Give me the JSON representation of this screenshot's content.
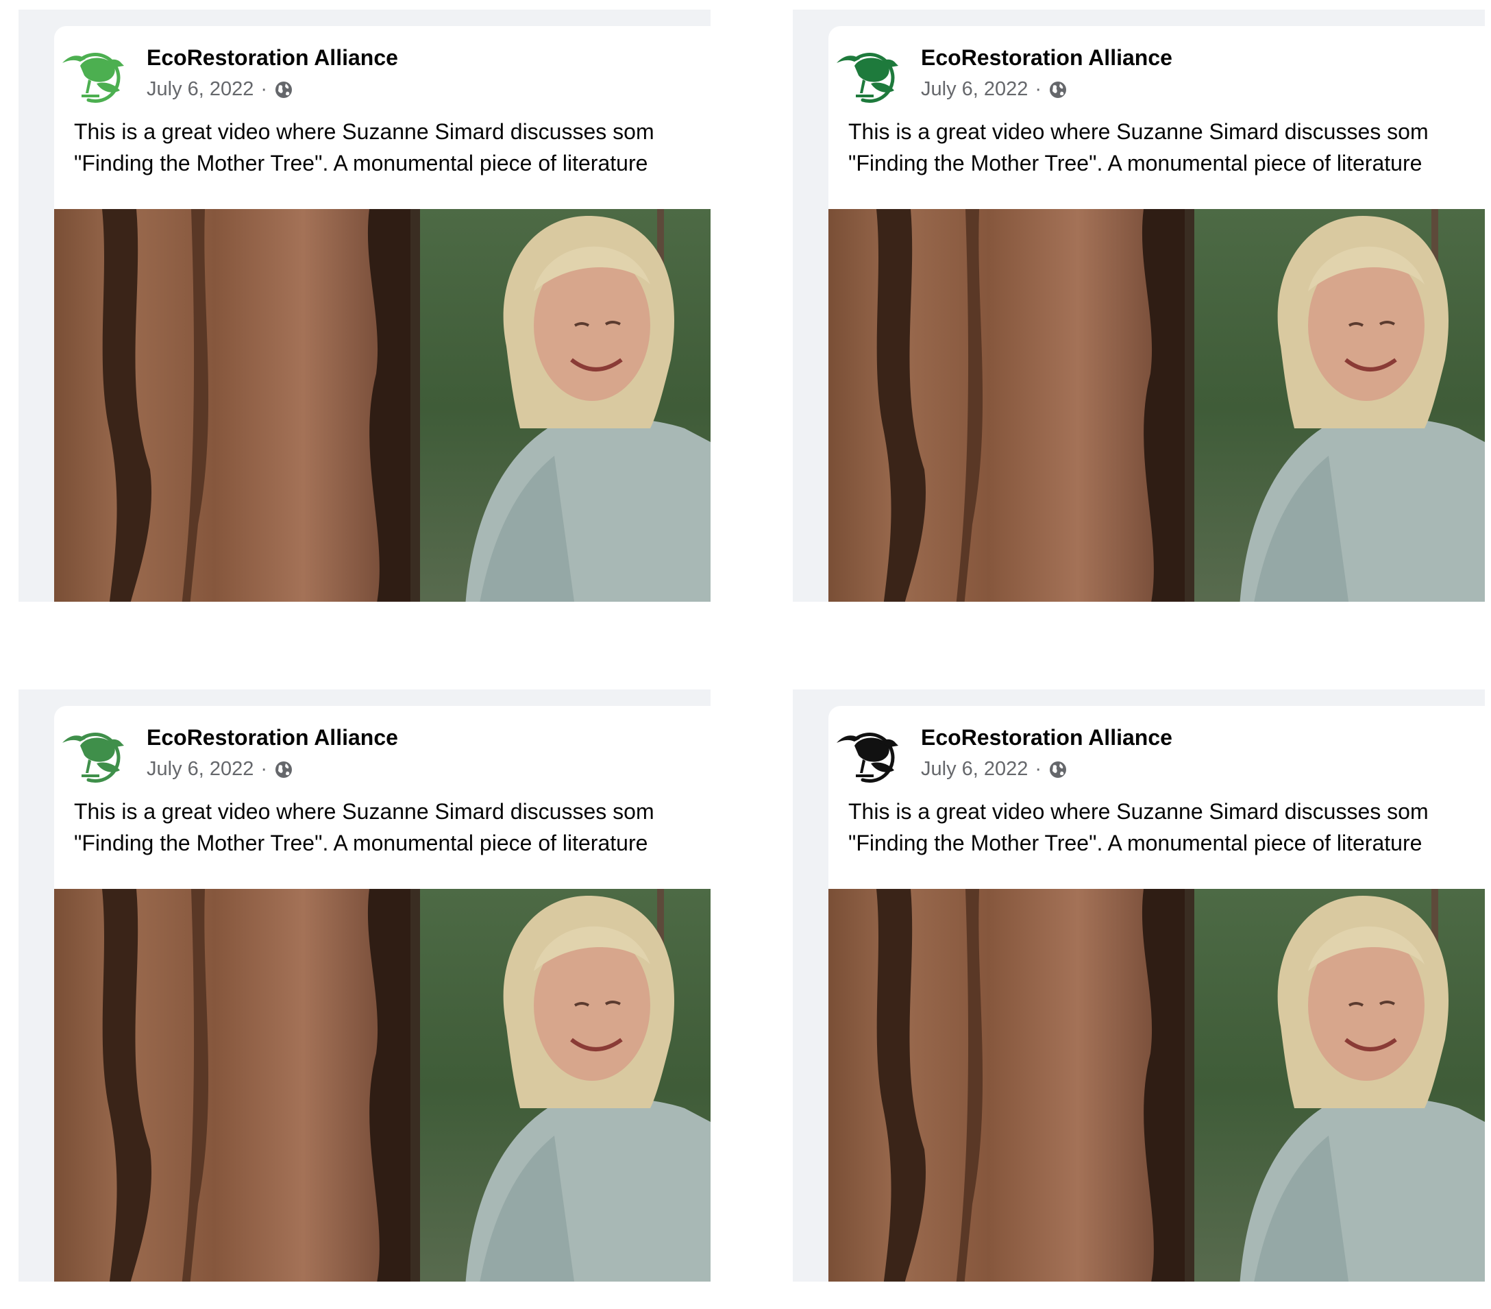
{
  "posts": [
    {
      "page_name": "EcoRestoration Alliance",
      "date": "July 6, 2022",
      "separator": "·",
      "audience_icon": "globe-icon",
      "logo_variant": "bright-green",
      "text_line_1": "This is a great video where Suzanne Simard discusses som",
      "text_line_2": "\"Finding the Mother Tree\". A monumental piece of literature"
    },
    {
      "page_name": "EcoRestoration Alliance",
      "date": "July 6, 2022",
      "separator": "·",
      "audience_icon": "globe-icon",
      "logo_variant": "dark-green",
      "text_line_1": "This is a great video where Suzanne Simard discusses som",
      "text_line_2": "\"Finding the Mother Tree\". A monumental piece of literature"
    },
    {
      "page_name": "EcoRestoration Alliance",
      "date": "July 6, 2022",
      "separator": "·",
      "audience_icon": "globe-icon",
      "logo_variant": "medium-green",
      "text_line_1": "This is a great video where Suzanne Simard discusses som",
      "text_line_2": "\"Finding the Mother Tree\". A monumental piece of literature"
    },
    {
      "page_name": "EcoRestoration Alliance",
      "date": "July 6, 2022",
      "separator": "·",
      "audience_icon": "globe-icon",
      "logo_variant": "black",
      "text_line_1": "This is a great video where Suzanne Simard discusses som",
      "text_line_2": "\"Finding the Mother Tree\". A monumental piece of literature"
    }
  ],
  "colors": {
    "background": "#f0f2f5",
    "card": "#ffffff",
    "name_text": "#050505",
    "meta_text": "#65676b",
    "logo_bright_green": "#4caf50",
    "logo_dark_green": "#1e7a3c",
    "logo_medium_green": "#3f8f4a",
    "logo_black": "#111111"
  }
}
